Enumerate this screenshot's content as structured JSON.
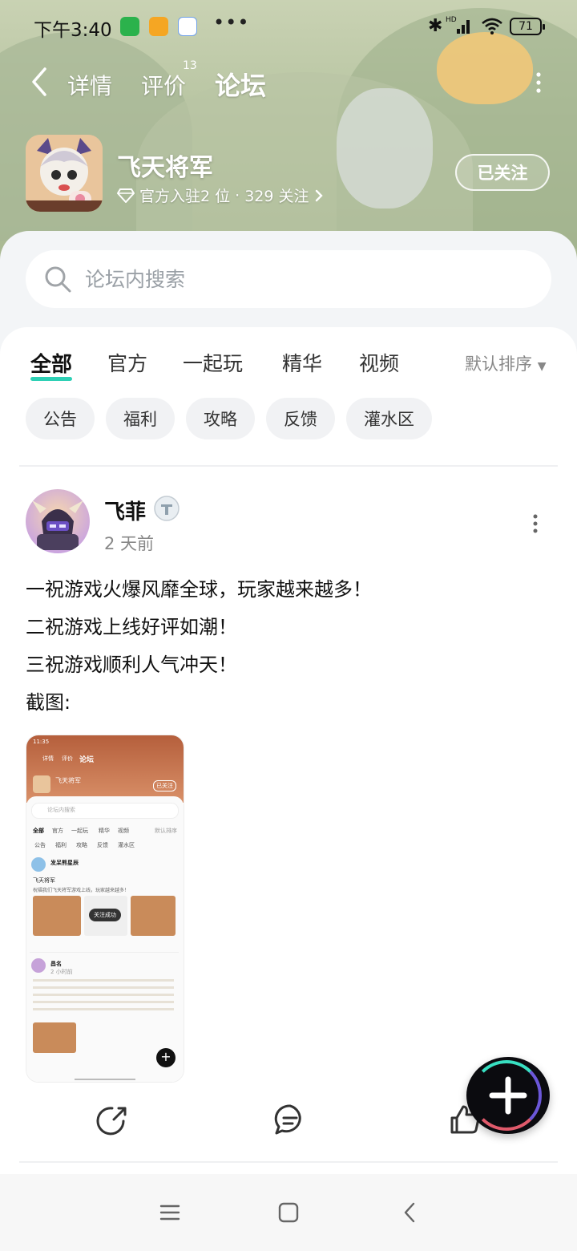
{
  "status_bar": {
    "time": "下午3:40",
    "dots": "•••",
    "network": "HD",
    "battery": "71"
  },
  "nav": {
    "tabs": [
      {
        "label": "详情"
      },
      {
        "label": "评价"
      },
      {
        "label": "论坛"
      }
    ],
    "review_count": "13"
  },
  "game": {
    "name": "飞天将军",
    "residents": "官方入驻2 位",
    "separator": "·",
    "followers": "329 关注",
    "follow_button": "已关注"
  },
  "search": {
    "placeholder": "论坛内搜索"
  },
  "categories": {
    "tabs": [
      "全部",
      "官方",
      "一起玩",
      "精华",
      "视频"
    ],
    "sort": "默认排序"
  },
  "chips": [
    "公告",
    "福利",
    "攻略",
    "反馈",
    "灌水区"
  ],
  "post": {
    "author": "飞菲",
    "time": "2 天前",
    "lines": [
      "一祝游戏火爆风靡全球，玩家越来越多！",
      "二祝游戏上线好评如潮！",
      "三祝游戏顺利人气冲天！",
      "截图:"
    ],
    "screenshot": {
      "time": "11:35",
      "tabs": [
        "详情",
        "评价",
        "论坛"
      ],
      "game_name": "飞天将军",
      "follow": "已关注",
      "search": "论坛内搜索",
      "categories": [
        "全部",
        "官方",
        "一起玩",
        "精华",
        "视频",
        "默认排序"
      ],
      "chips": [
        "公告",
        "福利",
        "攻略",
        "反馈",
        "灌水区"
      ],
      "toast": "关注成功",
      "user1": "发呆熊星辰",
      "user1_title": "飞天将军",
      "user1_text": "祝福我们飞天将军游戏上线，玩家越来越多！",
      "user2": "昌名",
      "user2_time": "2 小时前"
    }
  },
  "colors": {
    "accent": "#2ed0b5",
    "banner": "#b7c4a1",
    "sheet": "#f3f5f7"
  },
  "icons": {
    "back": "chevron-left-icon",
    "more": "more-vertical-icon",
    "search": "search-icon",
    "share": "share-icon",
    "comment": "comment-icon",
    "like": "thumb-up-icon",
    "fab": "plus-icon"
  }
}
